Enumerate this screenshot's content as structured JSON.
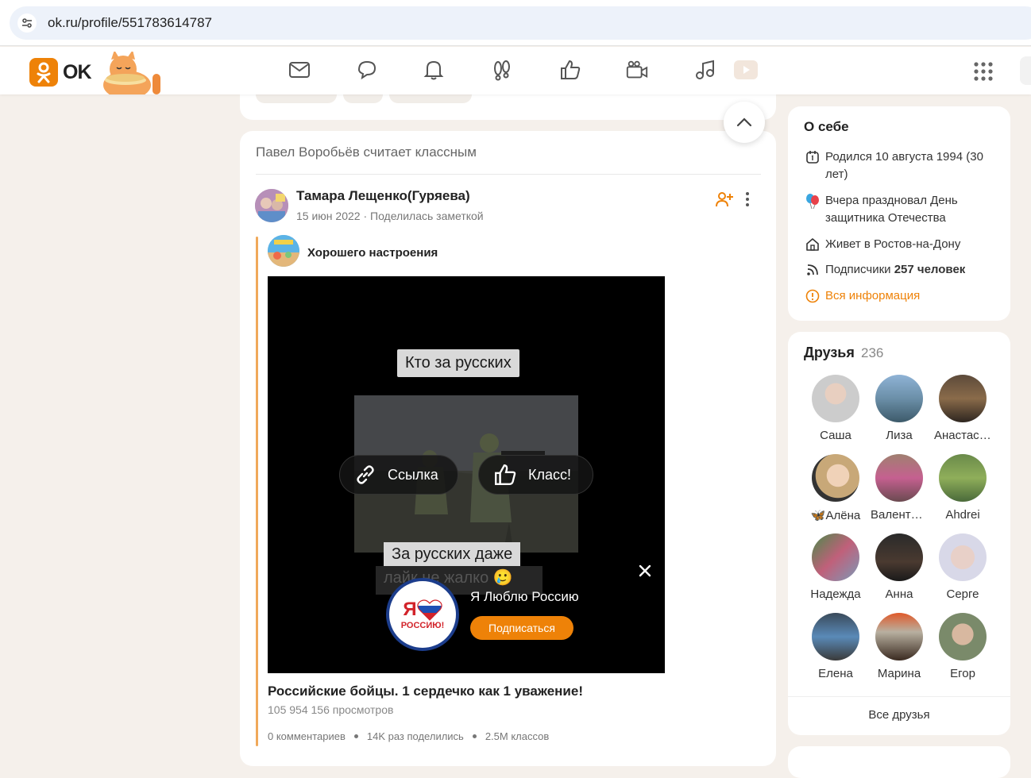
{
  "browser": {
    "url": "ok.ru/profile/551783614787"
  },
  "header": {
    "logo_text": "OK",
    "nav_icons": [
      "mail-icon",
      "chat-icon",
      "bell-icon",
      "guests-icon",
      "like-icon",
      "video-camera-icon",
      "music-icon",
      "play-icon"
    ],
    "accent_color": "#ee8208"
  },
  "post": {
    "liked_by": "Павел Воробьёв считает классным",
    "author": "Тамара Лещенко(Гуряева)",
    "date": "15 июн 2022",
    "action": "Поделилась заметкой",
    "group": "Хорошего настроения",
    "video": {
      "caption_top": "Кто за русских",
      "caption_bottom": "За русских даже",
      "caption_partial": "лайк не жалко 🥲",
      "link_button": "Ссылка",
      "like_button": "Класс!",
      "promo_title": "Я Люблю Россию",
      "promo_logo_ya": "Я",
      "promo_logo_text": "РОССИЮ!",
      "subscribe_button": "Подписаться"
    },
    "title": "Российские бойцы. 1 сердечко как 1 уважение!",
    "views": "105 954 156 просмотров",
    "comments": "0 комментариев",
    "shares": "14K раз поделились",
    "likes": "2.5M классов"
  },
  "about": {
    "title": "О себе",
    "birth": "Родился 10 августа 1994 (30 лет)",
    "holiday": "Вчера праздновал День защитника Отечества",
    "lives": "Живет в Ростов-на-Дону",
    "followers_label": "Подписчики",
    "followers_value": "257 человек",
    "all_info": "Вся информация"
  },
  "friends": {
    "title": "Друзья",
    "count": "236",
    "list": [
      "Саша",
      "Лиза",
      "Анастасия",
      "🦋Алёна",
      "Валентина",
      "Ahdrei",
      "Надежда",
      "Анна",
      "Серге",
      "Елена",
      "Марина",
      "Егор"
    ],
    "all_label": "Все друзья"
  }
}
